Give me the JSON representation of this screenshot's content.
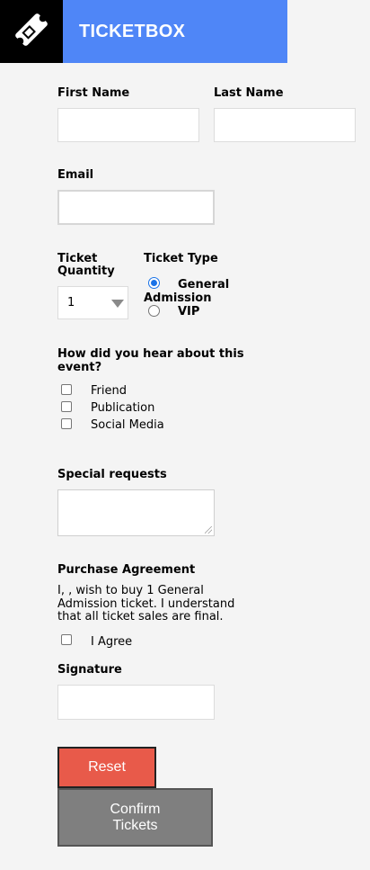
{
  "header": {
    "brand": "TICKETBOX",
    "logo_icon": "ticket-icon"
  },
  "form": {
    "first_name_label": "First Name",
    "last_name_label": "Last Name",
    "email_label": "Email",
    "ticket_quantity_label": "Ticket\nQuantity",
    "ticket_quantity_value": "1",
    "ticket_type_label": "Ticket Type",
    "ticket_types": [
      {
        "label": "General\nAdmission",
        "selected": true
      },
      {
        "label": "VIP",
        "selected": false
      }
    ],
    "hear_about_label": "How did you hear about this\nevent?",
    "hear_about_options": [
      "Friend",
      "Publication",
      "Social Media"
    ],
    "special_requests_label": "Special requests",
    "purchase_agreement_label": "Purchase Agreement",
    "agreement_text": "I, , wish to buy 1 General\nAdmission ticket. I understand\nthat all ticket sales are final.",
    "agree_label": "I Agree",
    "signature_label": "Signature",
    "reset_label": "Reset",
    "confirm_label": "Confirm\nTickets"
  },
  "colors": {
    "brand": "#4f86f7",
    "reset": "#e85a4a",
    "confirm": "#7f7f7f",
    "radio": "#1a73e8"
  }
}
